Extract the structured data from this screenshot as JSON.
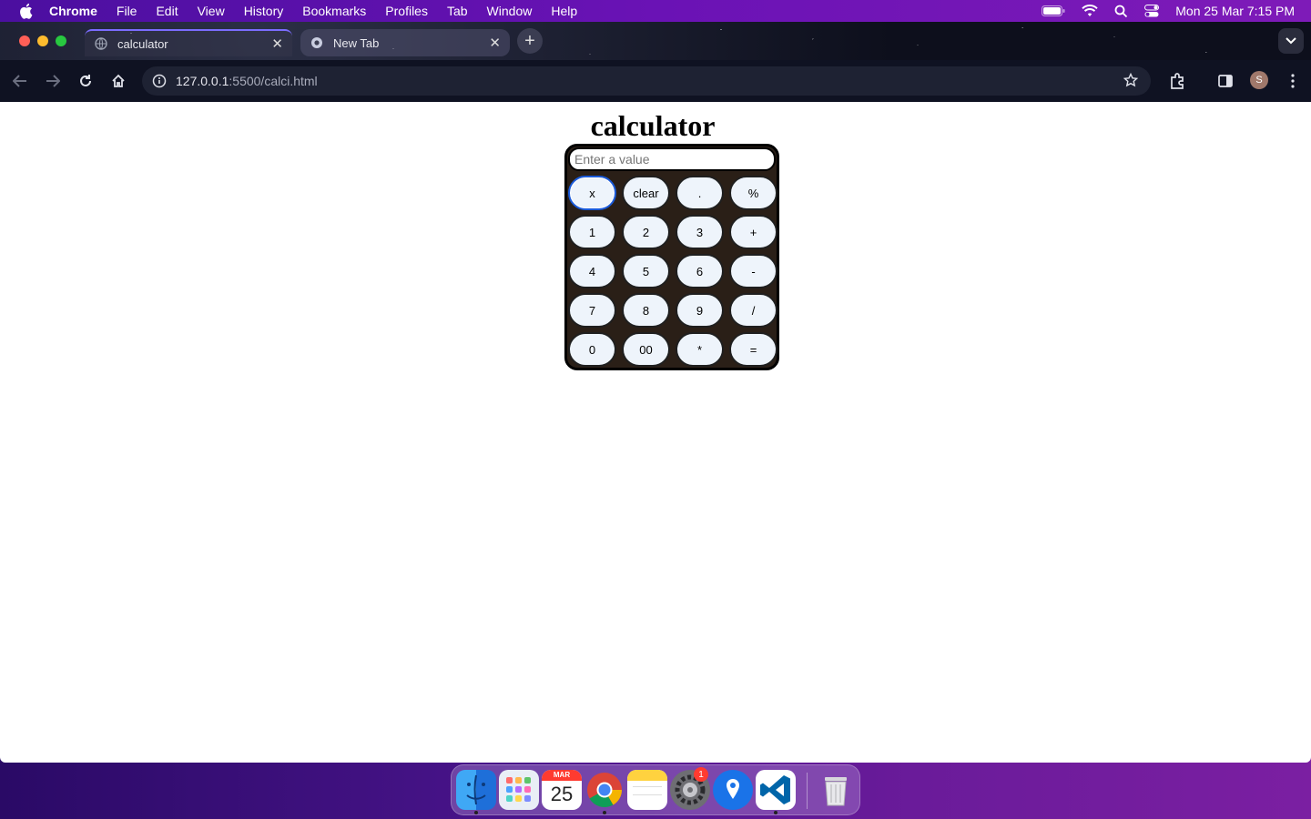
{
  "menubar": {
    "app_name": "Chrome",
    "items": [
      "File",
      "Edit",
      "View",
      "History",
      "Bookmarks",
      "Profiles",
      "Tab",
      "Window",
      "Help"
    ],
    "datetime": "Mon 25 Mar  7:15 PM"
  },
  "browser": {
    "tabs": [
      {
        "title": "calculator",
        "active": true
      },
      {
        "title": "New Tab",
        "active": false
      }
    ],
    "url_host": "127.0.0.1",
    "url_path": ":5500/calci.html",
    "avatar_letter": "S"
  },
  "page": {
    "title": "calculator",
    "input_placeholder": "Enter a value",
    "input_value": "",
    "keys": [
      [
        "x",
        "clear",
        ".",
        "%"
      ],
      [
        "1",
        "2",
        "3",
        "+"
      ],
      [
        "4",
        "5",
        "6",
        "-"
      ],
      [
        "7",
        "8",
        "9",
        "/"
      ],
      [
        "0",
        "00",
        "*",
        "="
      ]
    ]
  },
  "dock": {
    "apps": [
      "finder-icon",
      "launchpad-icon",
      "calendar-icon",
      "chrome-icon",
      "notes-icon",
      "system-settings-icon",
      "maps-icon",
      "vscode-icon",
      "trash-icon"
    ],
    "calendar_month": "MAR",
    "calendar_day": "25",
    "settings_badge": "1"
  }
}
